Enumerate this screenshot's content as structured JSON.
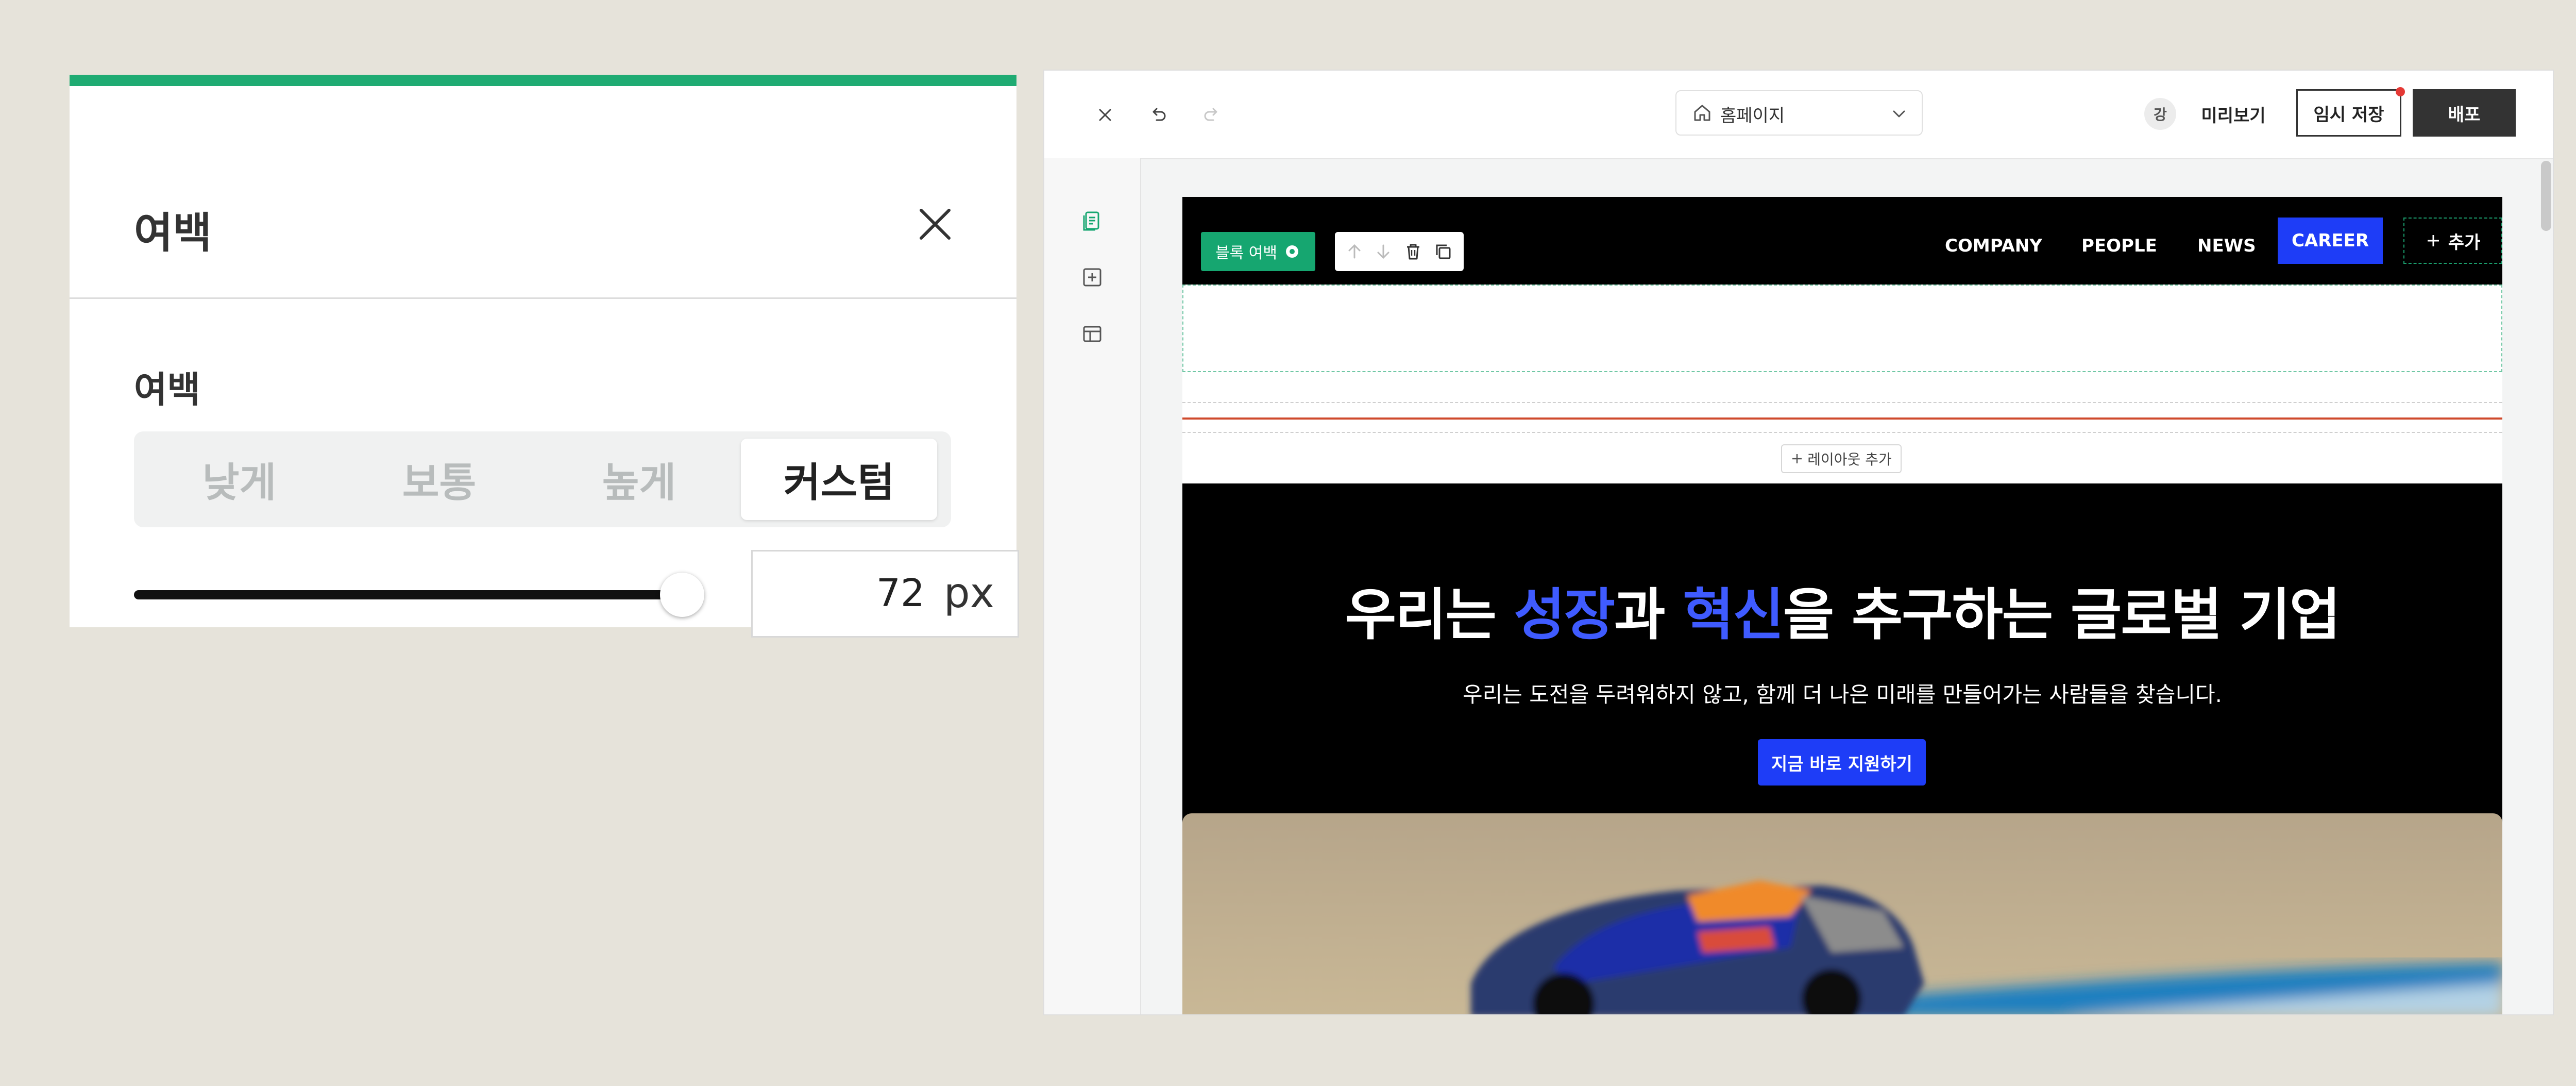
{
  "panel": {
    "title": "여백",
    "section_label": "여백",
    "options": [
      "낮게",
      "보통",
      "높게",
      "커스텀"
    ],
    "selected_option": "커스텀",
    "slider_fraction": 0.95,
    "value": "72",
    "unit": "px",
    "accent_color": "#1fab72"
  },
  "editor": {
    "page_select": {
      "label": "홈페이지"
    },
    "avatar_label": "강",
    "preview_label": "미리보기",
    "draft_label": "임시 저장",
    "deploy_label": "배포",
    "block_badge": "블록 여백",
    "nav_links": [
      "COMPANY",
      "PEOPLE",
      "NEWS"
    ],
    "career_label": "CAREER",
    "add_label": "추가",
    "add_layout_label": "레이아웃 추가",
    "hero": {
      "title_1": "우리는 ",
      "accent_1": "성장",
      "title_2": "과 ",
      "accent_2": "혁신",
      "title_3": "을 추구하는 글로벌 기업",
      "subtitle": "우리는 도전을 두려워하지 않고, 함께 더 나은 미래를 만들어가는 사람들을 찾습니다.",
      "cta": "지금 바로 지원하기"
    },
    "colors": {
      "brand_blue": "#1e3df7",
      "green": "#16a670"
    }
  }
}
